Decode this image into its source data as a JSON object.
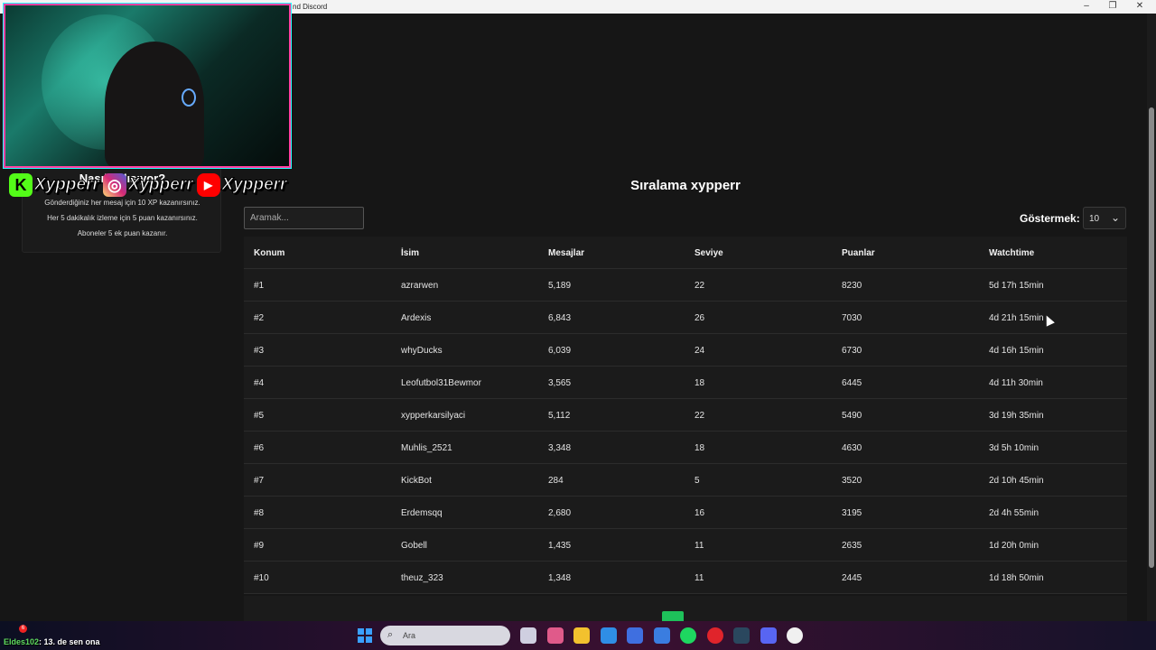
{
  "window": {
    "title": "nd Discord"
  },
  "overlay": {
    "socials": [
      {
        "icon": "kick-icon",
        "label": "K",
        "name": "Xypperr",
        "color": "#53fc18"
      },
      {
        "icon": "instagram-icon",
        "label": "◎",
        "name": "Xypperr",
        "color": "#d62976"
      },
      {
        "icon": "youtube-icon",
        "label": "▶",
        "name": "Xypperr",
        "color": "#ff0000"
      }
    ],
    "info": {
      "heading": "Nasıl çalışıyor?",
      "lines": [
        "Gönderdiğiniz her mesaj için 10 XP kazanırsınız.",
        "Her 5 dakikalık izleme için 5 puan kazanırsınız.",
        "Aboneler 5 ek puan kazanır."
      ]
    }
  },
  "leaderboard": {
    "title": "Sıralama xypperr",
    "search_placeholder": "Aramak...",
    "show_label": "Göstermek:",
    "show_value": "10",
    "columns": [
      "Konum",
      "İsim",
      "Mesajlar",
      "Seviye",
      "Puanlar",
      "Watchtime"
    ],
    "rows": [
      [
        "#1",
        "azrarwen",
        "5,189",
        "22",
        "8230",
        "5d 17h 15min"
      ],
      [
        "#2",
        "Ardexis",
        "6,843",
        "26",
        "7030",
        "4d 21h 15min"
      ],
      [
        "#3",
        "whyDucks",
        "6,039",
        "24",
        "6730",
        "4d 16h 15min"
      ],
      [
        "#4",
        "Leofutbol31Bewmor",
        "3,565",
        "18",
        "6445",
        "4d 11h 30min"
      ],
      [
        "#5",
        "xypperkarsilyaci",
        "5,112",
        "22",
        "5490",
        "3d 19h 35min"
      ],
      [
        "#6",
        "Muhlis_2521",
        "3,348",
        "18",
        "4630",
        "3d 5h 10min"
      ],
      [
        "#7",
        "KickBot",
        "284",
        "5",
        "3520",
        "2d 10h 45min"
      ],
      [
        "#8",
        "Erdemsqq",
        "2,680",
        "16",
        "3195",
        "2d 4h 55min"
      ],
      [
        "#9",
        "Gobell",
        "1,435",
        "11",
        "2635",
        "1d 20h 0min"
      ],
      [
        "#10",
        "theuz_323",
        "1,348",
        "11",
        "2445",
        "1d 18h 50min"
      ]
    ]
  },
  "chat": {
    "badge": "6",
    "user": "Eldes102",
    "message": ": 13. de sen ona"
  },
  "taskbar": {
    "search_placeholder": "Ara",
    "icons": [
      "task-view-icon",
      "widgets-icon",
      "file-explorer-icon",
      "edge-icon",
      "store-icon",
      "mail-icon",
      "spotify-icon",
      "opera-icon",
      "steam-icon",
      "discord-icon",
      "obs-icon"
    ]
  }
}
